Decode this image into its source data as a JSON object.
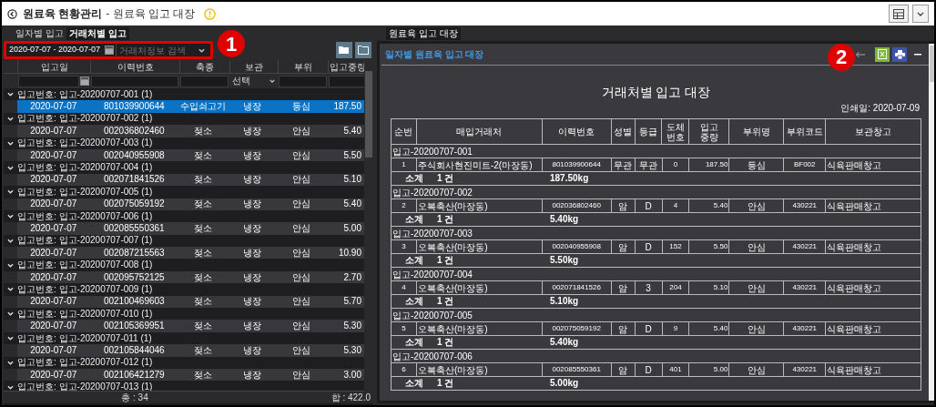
{
  "title_bar": {
    "title": "원료육 현황관리",
    "subtitle": "- 원료육 입고 대장"
  },
  "left_panel": {
    "tabs": [
      {
        "label": "일자별 입고",
        "selected": false
      },
      {
        "label": "거래처별 입고",
        "selected": true
      }
    ],
    "date_range": "2020-07-07 - 2020-07-07",
    "search": {
      "placeholder": "거래처정보 검색"
    },
    "callout": "1",
    "grid": {
      "columns": [
        "입고일",
        "이력번호",
        "축종",
        "보관",
        "부위",
        "입고중량"
      ],
      "select_placeholder": "선택",
      "groups": [
        {
          "label": "입고번호: 입고-20200707-001 (1)",
          "expanded": true,
          "rows": [
            {
              "cells": [
                "2020-07-07",
                "801039900644",
                "수입쇠고기",
                "냉장",
                "등심",
                "187.50"
              ],
              "selected": true
            }
          ]
        },
        {
          "label": "입고번호: 입고-20200707-002 (1)",
          "expanded": true,
          "rows": [
            {
              "cells": [
                "2020-07-07",
                "002036802460",
                "젖소",
                "냉장",
                "안심",
                "5.40"
              ],
              "selected": false
            }
          ]
        },
        {
          "label": "입고번호: 입고-20200707-003 (1)",
          "expanded": true,
          "rows": [
            {
              "cells": [
                "2020-07-07",
                "002040955908",
                "젖소",
                "냉장",
                "안심",
                "5.50"
              ],
              "selected": false
            }
          ]
        },
        {
          "label": "입고번호: 입고-20200707-004 (1)",
          "expanded": true,
          "rows": [
            {
              "cells": [
                "2020-07-07",
                "002071841526",
                "젖소",
                "냉장",
                "안심",
                "5.10"
              ],
              "selected": false
            }
          ]
        },
        {
          "label": "입고번호: 입고-20200707-005 (1)",
          "expanded": true,
          "rows": [
            {
              "cells": [
                "2020-07-07",
                "002075059192",
                "젖소",
                "냉장",
                "안심",
                "5.40"
              ],
              "selected": false
            }
          ]
        },
        {
          "label": "입고번호: 입고-20200707-006 (1)",
          "expanded": true,
          "rows": [
            {
              "cells": [
                "2020-07-07",
                "002085550361",
                "젖소",
                "냉장",
                "안심",
                "5.00"
              ],
              "selected": false
            }
          ]
        },
        {
          "label": "입고번호: 입고-20200707-007 (1)",
          "expanded": true,
          "rows": [
            {
              "cells": [
                "2020-07-07",
                "002087215563",
                "젖소",
                "냉장",
                "안심",
                "10.90"
              ],
              "selected": false
            }
          ]
        },
        {
          "label": "입고번호: 입고-20200707-008 (1)",
          "expanded": true,
          "rows": [
            {
              "cells": [
                "2020-07-07",
                "002095752125",
                "젖소",
                "냉장",
                "안심",
                "2.70"
              ],
              "selected": false
            }
          ]
        },
        {
          "label": "입고번호: 입고-20200707-009 (1)",
          "expanded": true,
          "rows": [
            {
              "cells": [
                "2020-07-07",
                "002100469603",
                "젖소",
                "냉장",
                "안심",
                "5.70"
              ],
              "selected": false
            }
          ]
        },
        {
          "label": "입고번호: 입고-20200707-010 (1)",
          "expanded": true,
          "rows": [
            {
              "cells": [
                "2020-07-07",
                "002105369951",
                "젖소",
                "냉장",
                "안심",
                "5.30"
              ],
              "selected": false
            }
          ]
        },
        {
          "label": "입고번호: 입고-20200707-011 (1)",
          "expanded": true,
          "rows": [
            {
              "cells": [
                "2020-07-07",
                "002105844046",
                "젖소",
                "냉장",
                "안심",
                "5.30"
              ],
              "selected": false
            }
          ]
        },
        {
          "label": "입고번호: 입고-20200707-012 (1)",
          "expanded": true,
          "rows": [
            {
              "cells": [
                "2020-07-07",
                "002106421279",
                "젖소",
                "냉장",
                "안심",
                "3.00"
              ],
              "selected": false
            }
          ]
        },
        {
          "label": "입고번호: 입고-20200707-013 (1)",
          "expanded": true
        }
      ],
      "footer": [
        "총 : 34",
        "합 : 422.0"
      ]
    }
  },
  "right_panel": {
    "tabs": [
      {
        "label": "원료육 입고 대장",
        "selected": true
      }
    ],
    "header": "일자별 원료육 입고 대장",
    "callout": "2",
    "report": {
      "title": "거래처별 입고 대장",
      "print_date": "인쇄일: 2020-07-09",
      "columns": [
        "순번",
        "매입거래처",
        "이력번호",
        "성별",
        "등급",
        "도체\n번호",
        "입고\n중량",
        "부위명",
        "부위코드",
        "보관창고"
      ],
      "groups": [
        {
          "label": "입고-20200707-001",
          "rows": [
            [
              "1",
              "주식회사현진미트-2(마장동)",
              "801039900644",
              "무관",
              "무관",
              "0",
              "187.50",
              "등심",
              "BF002",
              "식육판매창고"
            ]
          ],
          "subtotal": [
            "소계",
            "1 건",
            "187.50kg"
          ]
        },
        {
          "label": "입고-20200707-002",
          "rows": [
            [
              "2",
              "오복축산(마장동)",
              "002036802460",
              "암",
              "D",
              "4",
              "5.40",
              "안심",
              "430221",
              "식육판매창고"
            ]
          ],
          "subtotal": [
            "소계",
            "1 건",
            "5.40kg"
          ]
        },
        {
          "label": "입고-20200707-003",
          "rows": [
            [
              "3",
              "오복축산(마장동)",
              "002040955908",
              "암",
              "D",
              "152",
              "5.50",
              "안심",
              "430221",
              "식육판매창고"
            ]
          ],
          "subtotal": [
            "소계",
            "1 건",
            "5.50kg"
          ]
        },
        {
          "label": "입고-20200707-004",
          "rows": [
            [
              "4",
              "오복축산(마장동)",
              "002071841526",
              "암",
              "3",
              "204",
              "5.10",
              "안심",
              "430221",
              "식육판매창고"
            ]
          ],
          "subtotal": [
            "소계",
            "1 건",
            "5.10kg"
          ]
        },
        {
          "label": "입고-20200707-005",
          "rows": [
            [
              "5",
              "오복축산(마장동)",
              "002075059192",
              "암",
              "D",
              "9",
              "5.40",
              "안심",
              "430221",
              "식육판매창고"
            ]
          ],
          "subtotal": [
            "소계",
            "1 건",
            "5.40kg"
          ]
        },
        {
          "label": "입고-20200707-006",
          "rows": [
            [
              "6",
              "오복축산(마장동)",
              "002085550361",
              "암",
              "D",
              "401",
              "5.00",
              "안심",
              "430221",
              "식육판매창고"
            ]
          ],
          "subtotal": [
            "소계",
            "1 건",
            "5.00kg"
          ]
        }
      ]
    }
  }
}
